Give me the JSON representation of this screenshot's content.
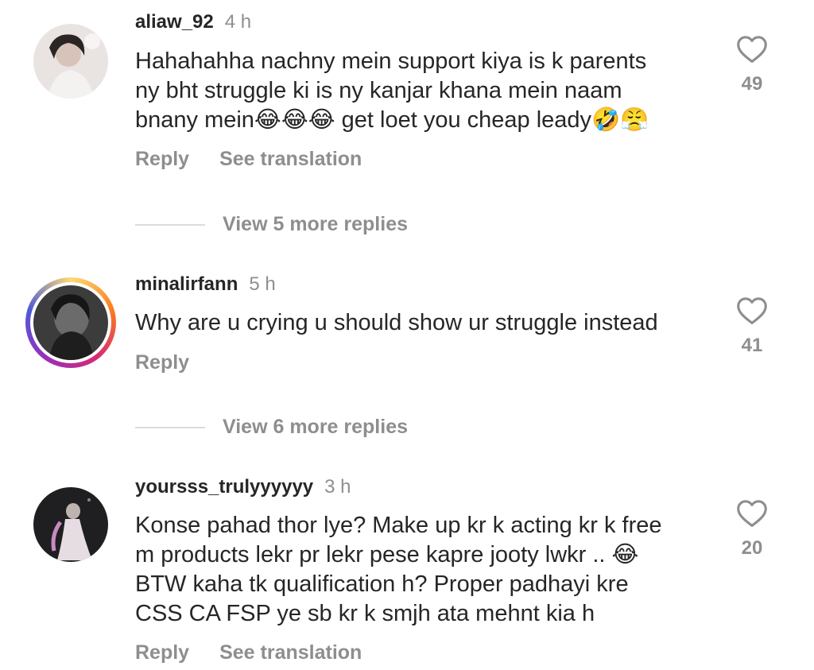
{
  "comments": [
    {
      "username": "aliaw_92",
      "time": "4 h",
      "text_lines": [
        "Hahahahha nachny mein support kiya is k parents",
        "ny bht struggle ki is ny kanjar khana mein naam",
        "bnany mein😂😂😂 get loet you cheap leady🤣😤"
      ],
      "actions": [
        "Reply",
        "See translation"
      ],
      "likes": "49",
      "view_replies": "View 5 more replies"
    },
    {
      "username": "minalirfann",
      "time": "5 h",
      "text_lines": [
        "Why are u crying u should show ur struggle instead"
      ],
      "actions": [
        "Reply"
      ],
      "likes": "41",
      "view_replies": "View 6 more replies"
    },
    {
      "username": "yoursss_trulyyyyyy",
      "time": "3 h",
      "text_lines": [
        "Konse pahad thor lye? Make up kr k acting kr k free",
        "m products lekr pr lekr pese kapre jooty lwkr .. 😂",
        "BTW kaha tk qualification h? Proper padhayi kre",
        "CSS CA FSP ye sb kr k smjh ata mehnt kia h"
      ],
      "actions": [
        "Reply",
        "See translation"
      ],
      "likes": "20"
    }
  ],
  "icons": {
    "like": "heart-outline-icon"
  },
  "colors": {
    "text": "#262626",
    "muted": "#8e8e8e",
    "divider": "#dbdbdb"
  }
}
